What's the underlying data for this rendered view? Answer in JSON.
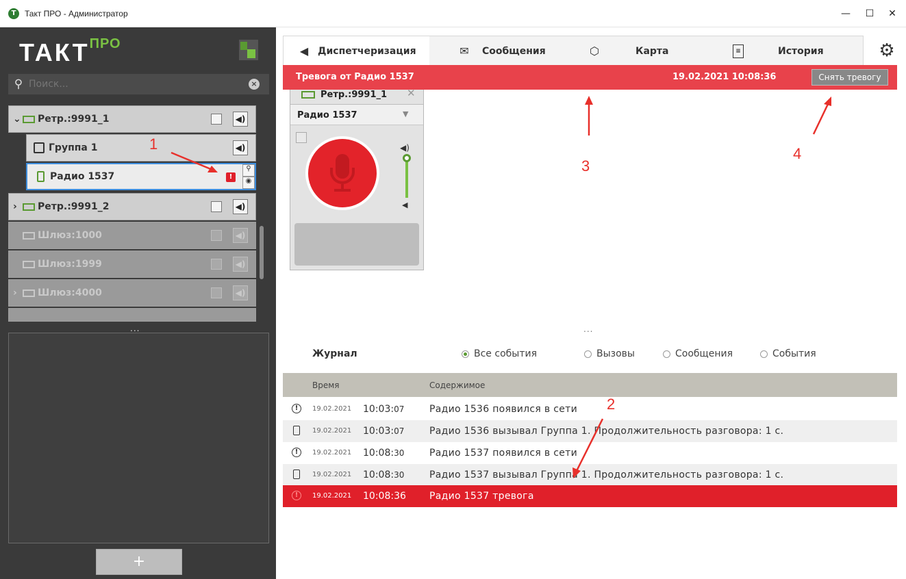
{
  "window": {
    "app_icon_letter": "Т",
    "title": "Такт ПРО - Администратор",
    "minimize": "—",
    "maximize": "☐",
    "close": "✕"
  },
  "brand": {
    "logo": "ТАКТ",
    "logo_sup": "ПРО",
    "accent": "#7ac143"
  },
  "search": {
    "placeholder": "Поиск...",
    "clear": "×"
  },
  "tree": [
    {
      "label": "Ретр.:9991_1",
      "chevron": "⌄",
      "state": "expanded"
    },
    {
      "label": "Группа 1",
      "type": "group"
    },
    {
      "label": "Радио 1537",
      "type": "radio",
      "selected": true,
      "alarm": "!"
    },
    {
      "label": "Ретр.:9991_2",
      "chevron": "›",
      "state": "collapsed"
    },
    {
      "label": "Шлюз:1000",
      "state": "disabled"
    },
    {
      "label": "Шлюз:1999",
      "state": "disabled"
    },
    {
      "label": "Шлюз:4000",
      "chevron": "›",
      "state": "disabled"
    }
  ],
  "left_dots": "...",
  "add_button": "+",
  "tabs": [
    {
      "label": "Диспетчеризация",
      "icon": "dispatch-icon",
      "active": true
    },
    {
      "label": "Сообщения",
      "icon": "envelope-icon"
    },
    {
      "label": "Карта",
      "icon": "map-icon"
    },
    {
      "label": "История",
      "icon": "document-icon"
    }
  ],
  "alarm_bar": {
    "title": "Тревога от Радио 1537",
    "time": "19.02.2021 10:08:36",
    "dismiss": "Снять тревогу",
    "color": "#e8424b"
  },
  "card": {
    "title": "Ретр.:9991_1",
    "close": "✕",
    "selected": "Радио 1537",
    "arrow": "▼"
  },
  "middle_dots": "...",
  "journal": {
    "title": "Журнал",
    "filters": [
      {
        "label": "Все события",
        "selected": true
      },
      {
        "label": "Вызовы",
        "selected": false
      },
      {
        "label": "Сообщения",
        "selected": false
      },
      {
        "label": "События",
        "selected": false
      }
    ],
    "columns": {
      "time": "Время",
      "content": "Содержимое"
    },
    "rows": [
      {
        "icon": "info",
        "date": "19.02.2021",
        "hm": "10:03:",
        "sec": "07",
        "text": "Радио 1536  появился в сети"
      },
      {
        "icon": "call",
        "date": "19.02.2021",
        "hm": "10:03:",
        "sec": "07",
        "text": "Радио 1536 вызывал  Группа 1.  Продолжительность разговора:  1 с."
      },
      {
        "icon": "info",
        "date": "19.02.2021",
        "hm": "10:08:",
        "sec": "30",
        "text": "Радио 1537  появился в сети"
      },
      {
        "icon": "call",
        "date": "19.02.2021",
        "hm": "10:08:",
        "sec": "30",
        "text": "Радио 1537 вызывал  Группа 1.  Продолжительность разговора:  1 с."
      },
      {
        "icon": "info",
        "date": "19.02.2021",
        "hm": "10:08:36",
        "sec": "",
        "text": "Радио 1537  тревога",
        "alarm": true
      }
    ]
  },
  "annotations": {
    "n1": "1",
    "n2": "2",
    "n3": "3",
    "n4": "4",
    "color": "#e8302b"
  }
}
